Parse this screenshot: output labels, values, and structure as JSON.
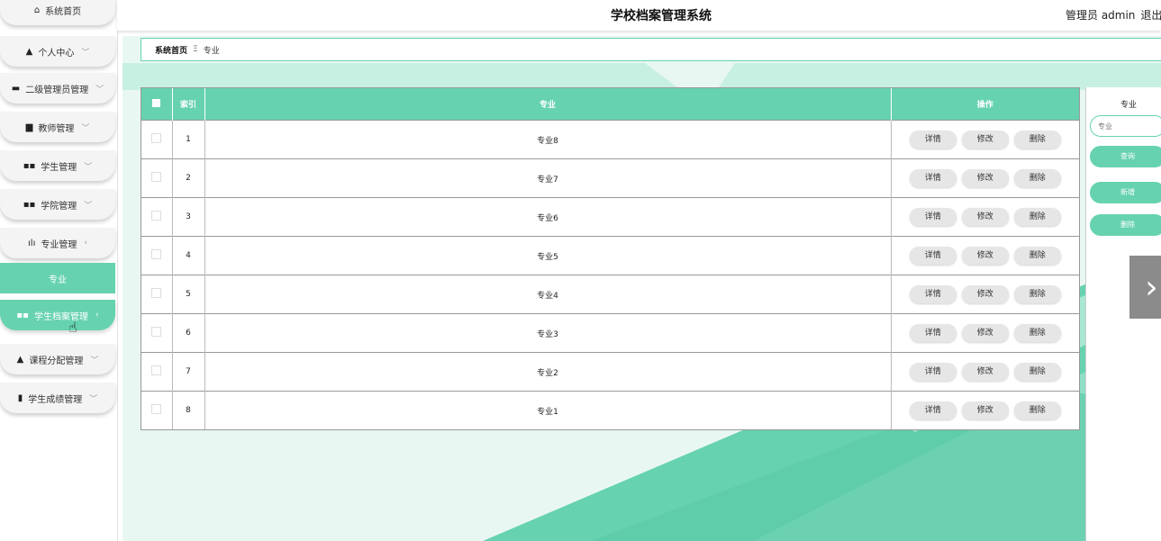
{
  "header": {
    "title": "学校档案管理系统",
    "user_label": "管理员 admin",
    "logout_label": "退出登录"
  },
  "sidebar": {
    "items": [
      {
        "label": "系统首页",
        "icon": "home-icon"
      },
      {
        "label": "个人中心",
        "icon": "user-icon"
      },
      {
        "label": "二级管理员管理",
        "icon": "briefcase-icon"
      },
      {
        "label": "教师管理",
        "icon": "book-icon"
      },
      {
        "label": "学生管理",
        "icon": "grid-icon"
      },
      {
        "label": "学院管理",
        "icon": "grid-icon"
      },
      {
        "label": "专业管理",
        "icon": "bar-chart-icon"
      },
      {
        "label": "学生档案管理",
        "icon": "grid-icon"
      },
      {
        "label": "课程分配管理",
        "icon": "user-icon"
      },
      {
        "label": "学生成绩管理",
        "icon": "clipboard-icon"
      }
    ],
    "sub_item": "专业"
  },
  "breadcrumb": {
    "home": "系统首页",
    "current": "专业"
  },
  "table": {
    "columns": [
      "索引",
      "专业",
      "操作"
    ],
    "rows": [
      {
        "index": "1",
        "name": "专业8"
      },
      {
        "index": "2",
        "name": "专业7"
      },
      {
        "index": "3",
        "name": "专业6"
      },
      {
        "index": "4",
        "name": "专业5"
      },
      {
        "index": "5",
        "name": "专业4"
      },
      {
        "index": "6",
        "name": "专业3"
      },
      {
        "index": "7",
        "name": "专业2"
      },
      {
        "index": "8",
        "name": "专业1"
      }
    ],
    "actions": {
      "detail": "详情",
      "edit": "修改",
      "delete": "删除"
    }
  },
  "search": {
    "label": "专业",
    "placeholder": "专业",
    "query_label": "查询",
    "add_label": "新增",
    "delete_label": "删除"
  },
  "colors": {
    "accent": "#66d2b0",
    "header_bg": "#ffffff"
  }
}
